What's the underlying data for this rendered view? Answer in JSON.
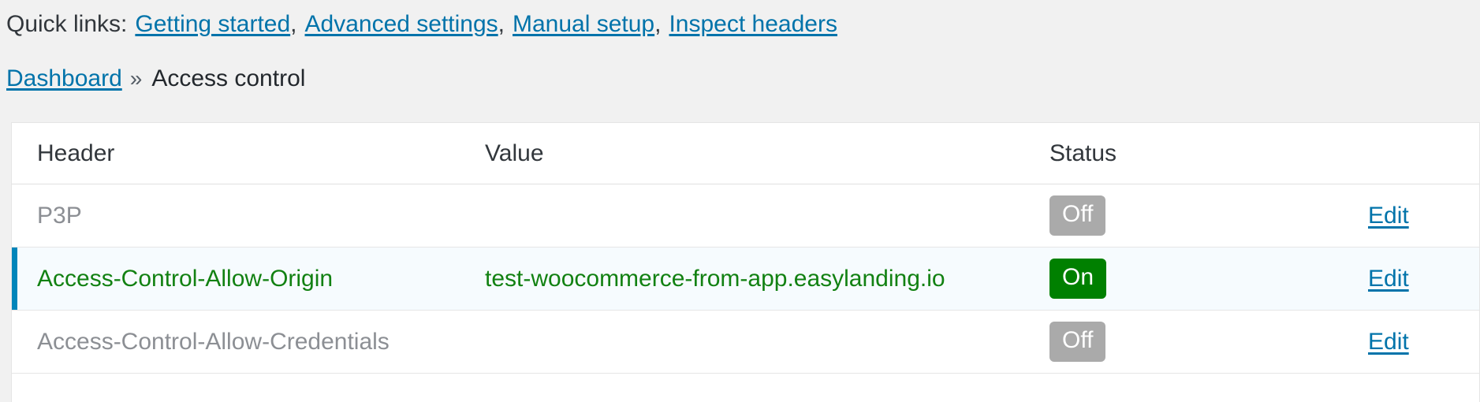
{
  "quick_links": {
    "label": "Quick links:",
    "links": [
      {
        "text": "Getting started"
      },
      {
        "text": "Advanced settings"
      },
      {
        "text": "Manual setup"
      },
      {
        "text": "Inspect headers"
      }
    ],
    "separator": ","
  },
  "breadcrumb": {
    "root": "Dashboard",
    "chevron": "»",
    "current": "Access control"
  },
  "table": {
    "columns": {
      "header": "Header",
      "value": "Value",
      "status": "Status"
    },
    "action_label": "Edit",
    "rows": [
      {
        "header": "P3P",
        "value": "",
        "status": "Off",
        "status_state": "off",
        "action": "Edit",
        "highlighted": false,
        "tone": "muted"
      },
      {
        "header": "Access-Control-Allow-Origin",
        "value": "test-woocommerce-from-app.easylanding.io",
        "status": "On",
        "status_state": "on",
        "action": "Edit",
        "highlighted": true,
        "tone": "active"
      },
      {
        "header": "Access-Control-Allow-Credentials",
        "value": "",
        "status": "Off",
        "status_state": "off",
        "action": "Edit",
        "highlighted": false,
        "tone": "muted"
      }
    ]
  },
  "colors": {
    "page_background": "#f1f1f1",
    "panel_background": "#ffffff",
    "link": "#0073aa",
    "accent_bar": "#0085ba",
    "highlight_row": "#f6fbfe",
    "badge_off": "#aaaaaa",
    "badge_on": "#008000",
    "text_muted": "#8c8f94",
    "text_active": "#128112",
    "text_default": "#32373c"
  }
}
